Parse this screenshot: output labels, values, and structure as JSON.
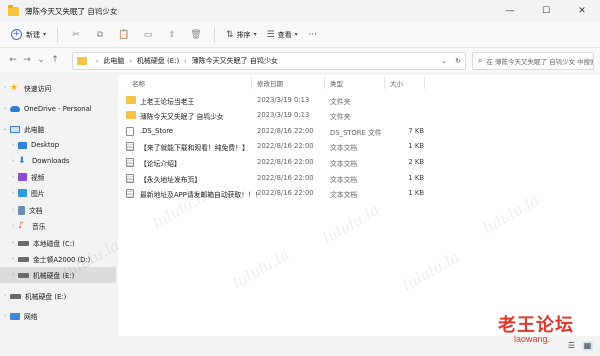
{
  "window": {
    "title": "薄陈今天又失眠了 自鸨少女",
    "controls": {
      "minimize": "—",
      "maximize": "☐",
      "close": "✕"
    }
  },
  "toolbar": {
    "new_label": "新建",
    "sort_label": "排序",
    "view_label": "查看",
    "more_label": "···"
  },
  "address": {
    "crumbs": [
      "此电脑",
      "机械硬盘 (E:)",
      "薄陈今天又失眠了 自鸨少女"
    ],
    "search_placeholder": "在 薄陈今天又失眠了 自鸨少女 中搜索"
  },
  "sidebar": {
    "items": [
      {
        "label": "快速访问",
        "icon": "star-icon"
      },
      {
        "label": "OneDrive - Personal",
        "icon": "cloud-icon"
      },
      {
        "label": "此电脑",
        "icon": "pc-icon"
      },
      {
        "label": "Desktop",
        "icon": "desktop-icon"
      },
      {
        "label": "Downloads",
        "icon": "download-icon"
      },
      {
        "label": "视频",
        "icon": "video-icon"
      },
      {
        "label": "图片",
        "icon": "picture-icon"
      },
      {
        "label": "文档",
        "icon": "document-icon"
      },
      {
        "label": "音乐",
        "icon": "music-icon"
      },
      {
        "label": "本地磁盘 (C:)",
        "icon": "drive-icon"
      },
      {
        "label": "金士顿A2000 (D:)",
        "icon": "drive-icon"
      },
      {
        "label": "机械硬盘 (E:)",
        "icon": "drive-icon"
      },
      {
        "label": "机械硬盘 (E:)",
        "icon": "drive-icon"
      },
      {
        "label": "网络",
        "icon": "network-icon"
      }
    ]
  },
  "columns": {
    "name": "名称",
    "date": "修改日期",
    "type": "类型",
    "size": "大小"
  },
  "files": [
    {
      "name": "上老王论坛当老王",
      "date": "2023/3/19 0:13",
      "type": "文件夹",
      "size": "",
      "icon": "folder-icon"
    },
    {
      "name": "薄陈今天又失眠了 自鸨少女",
      "date": "2023/3/19 0:13",
      "type": "文件夹",
      "size": "",
      "icon": "folder-icon"
    },
    {
      "name": ".DS_Store",
      "date": "2022/8/16 22:00",
      "type": "DS_STORE 文件",
      "size": "7 KB",
      "icon": "file-icon"
    },
    {
      "name": "【来了就能下载和观看！纯免费！】",
      "date": "2022/8/16 22:00",
      "type": "文本文档",
      "size": "1 KB",
      "icon": "text-file-icon"
    },
    {
      "name": "【论坛介绍】",
      "date": "2022/8/16 22:00",
      "type": "文本文档",
      "size": "2 KB",
      "icon": "text-file-icon"
    },
    {
      "name": "【永久地址发布页】",
      "date": "2022/8/16 22:00",
      "type": "文本文档",
      "size": "1 KB",
      "icon": "text-file-icon"
    },
    {
      "name": "最新地址及APP请发邮箱自动获取！！！",
      "date": "2022/8/16 22:00",
      "type": "文本文档",
      "size": "1 KB",
      "icon": "text-file-icon"
    }
  ],
  "watermark": {
    "text": "lululu.la",
    "logo_cn": "老王论坛",
    "logo_url": "laowang."
  },
  "colors": {
    "folder": "#f5c242",
    "accent": "#3f6ed8",
    "selection": "#dcdcdc",
    "logo": "#e0382f"
  }
}
